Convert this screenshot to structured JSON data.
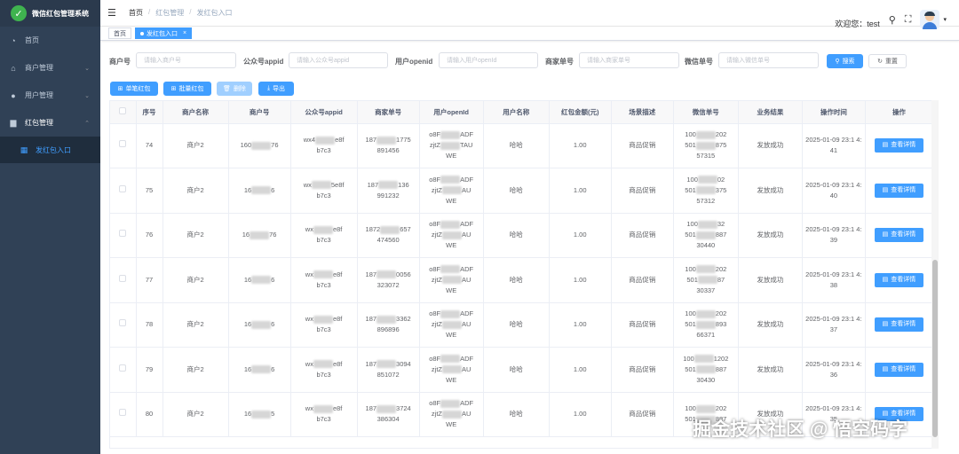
{
  "app": {
    "title": "微信红包管理系统"
  },
  "sidebar": {
    "items": [
      {
        "label": "首页",
        "icon": "dashboard-icon"
      },
      {
        "label": "商户管理",
        "icon": "shop-icon"
      },
      {
        "label": "用户管理",
        "icon": "user-icon"
      },
      {
        "label": "红包管理",
        "icon": "redpacket-icon"
      }
    ],
    "subitems": [
      {
        "label": "发红包入口",
        "icon": "grid-icon"
      }
    ]
  },
  "header": {
    "breadcrumb": [
      "首页",
      "红包管理",
      "发红包入口"
    ],
    "welcome": "欢迎您：test"
  },
  "tags": [
    {
      "label": "首页"
    },
    {
      "label": "发红包入口"
    }
  ],
  "search": {
    "merchant_no": {
      "label": "商户号",
      "placeholder": "请输入商户号"
    },
    "appid": {
      "label": "公众号appid",
      "placeholder": "请输入公众号appid"
    },
    "openid": {
      "label": "用户openid",
      "placeholder": "请输入用户openId"
    },
    "merchant_order": {
      "label": "商家单号",
      "placeholder": "请输入商家单号"
    },
    "wechat_order": {
      "label": "微信单号",
      "placeholder": "请输入微信单号"
    },
    "search_btn": "搜索",
    "reset_btn": "重置"
  },
  "toolbar": {
    "single": "单笔红包",
    "batch": "批量红包",
    "delete": "删除",
    "export": "导出"
  },
  "table": {
    "columns": [
      "",
      "序号",
      "商户名称",
      "商户号",
      "公众号appid",
      "商家单号",
      "用户openId",
      "用户名称",
      "红包金额(元)",
      "场景描述",
      "微信单号",
      "业务结果",
      "操作时间",
      "操作"
    ],
    "detail_label": "查看详情",
    "rows": [
      {
        "no": "74",
        "merchant": "商户2",
        "mch_a": "160",
        "mch_b": "76",
        "appid_a": "wx4",
        "appid_b": "e8f",
        "appid_c": "b7c3",
        "order_a": "187",
        "order_b": "1775",
        "order_c": "891456",
        "openid_a": "o8F",
        "openid_b": "ADF",
        "openid_c": "zjtZ",
        "openid_d": "TAU",
        "openid_e": "WE",
        "user": "哈哈",
        "amount": "1.00",
        "scene": "商品促销",
        "wx_a": "100",
        "wx_b": "202",
        "wx_c": "501",
        "wx_d": "875",
        "wx_e": "57315",
        "result": "发放成功",
        "time": "2025-01-09 23:1 4:41"
      },
      {
        "no": "75",
        "merchant": "商户2",
        "mch_a": "16",
        "mch_b": "6",
        "appid_a": "wx",
        "appid_b": "5e8f",
        "appid_c": "b7c3",
        "order_a": "187",
        "order_b": "136",
        "order_c": "991232",
        "openid_a": "o8F",
        "openid_b": "ADF",
        "openid_c": "zjtZ",
        "openid_d": "AU",
        "openid_e": "WE",
        "user": "哈哈",
        "amount": "1.00",
        "scene": "商品促销",
        "wx_a": "100",
        "wx_b": "02",
        "wx_c": "501",
        "wx_d": "375",
        "wx_e": "57312",
        "result": "发放成功",
        "time": "2025-01-09 23:1 4:40"
      },
      {
        "no": "76",
        "merchant": "商户2",
        "mch_a": "16",
        "mch_b": "76",
        "appid_a": "wx",
        "appid_b": "e8f",
        "appid_c": "b7c3",
        "order_a": "1872",
        "order_b": "657",
        "order_c": "474560",
        "openid_a": "o8F",
        "openid_b": "ADF",
        "openid_c": "zjtZ",
        "openid_d": "AU",
        "openid_e": "WE",
        "user": "哈哈",
        "amount": "1.00",
        "scene": "商品促销",
        "wx_a": "100",
        "wx_b": "32",
        "wx_c": "501",
        "wx_d": "887",
        "wx_e": "30440",
        "result": "发放成功",
        "time": "2025-01-09 23:1 4:39"
      },
      {
        "no": "77",
        "merchant": "商户2",
        "mch_a": "16",
        "mch_b": "6",
        "appid_a": "wx",
        "appid_b": "e8f",
        "appid_c": "b7c3",
        "order_a": "187",
        "order_b": "0056",
        "order_c": "323072",
        "openid_a": "o8F",
        "openid_b": "ADF",
        "openid_c": "zjtZ",
        "openid_d": "AU",
        "openid_e": "WE",
        "user": "哈哈",
        "amount": "1.00",
        "scene": "商品促销",
        "wx_a": "100",
        "wx_b": "202",
        "wx_c": "501",
        "wx_d": "87",
        "wx_e": "30337",
        "result": "发放成功",
        "time": "2025-01-09 23:1 4:38"
      },
      {
        "no": "78",
        "merchant": "商户2",
        "mch_a": "16",
        "mch_b": "6",
        "appid_a": "wx",
        "appid_b": "e8f",
        "appid_c": "b7c3",
        "order_a": "187",
        "order_b": "3362",
        "order_c": "896896",
        "openid_a": "o8F",
        "openid_b": "ADF",
        "openid_c": "zjtZ",
        "openid_d": "AU",
        "openid_e": "WE",
        "user": "哈哈",
        "amount": "1.00",
        "scene": "商品促销",
        "wx_a": "100",
        "wx_b": "202",
        "wx_c": "501",
        "wx_d": "893",
        "wx_e": "66371",
        "result": "发放成功",
        "time": "2025-01-09 23:1 4:37"
      },
      {
        "no": "79",
        "merchant": "商户2",
        "mch_a": "16",
        "mch_b": "6",
        "appid_a": "wx",
        "appid_b": "e8f",
        "appid_c": "b7c3",
        "order_a": "187",
        "order_b": "3094",
        "order_c": "851072",
        "openid_a": "o8F",
        "openid_b": "ADF",
        "openid_c": "zjtZ",
        "openid_d": "AU",
        "openid_e": "WE",
        "user": "哈哈",
        "amount": "1.00",
        "scene": "商品促销",
        "wx_a": "100",
        "wx_b": "1202",
        "wx_c": "501",
        "wx_d": "887",
        "wx_e": "30430",
        "result": "发放成功",
        "time": "2025-01-09 23:1 4:36"
      },
      {
        "no": "80",
        "merchant": "商户2",
        "mch_a": "16",
        "mch_b": "5",
        "appid_a": "wx",
        "appid_b": "e8f",
        "appid_c": "b7c3",
        "order_a": "187",
        "order_b": "3724",
        "order_c": "386304",
        "openid_a": "o8F",
        "openid_b": "ADF",
        "openid_c": "zjtZ",
        "openid_d": "AU",
        "openid_e": "WE",
        "user": "哈哈",
        "amount": "1.00",
        "scene": "商品促销",
        "wx_a": "100",
        "wx_b": "202",
        "wx_c": "501",
        "wx_d": "887",
        "wx_e": "",
        "result": "发放成功",
        "time": "2025-01-09 23:1 4:35"
      }
    ]
  },
  "watermark": "掘金技术社区 @ 悟空码字",
  "colors": {
    "sidebar": "#304156",
    "primary": "#409eff",
    "logo": "#3fb34f"
  }
}
